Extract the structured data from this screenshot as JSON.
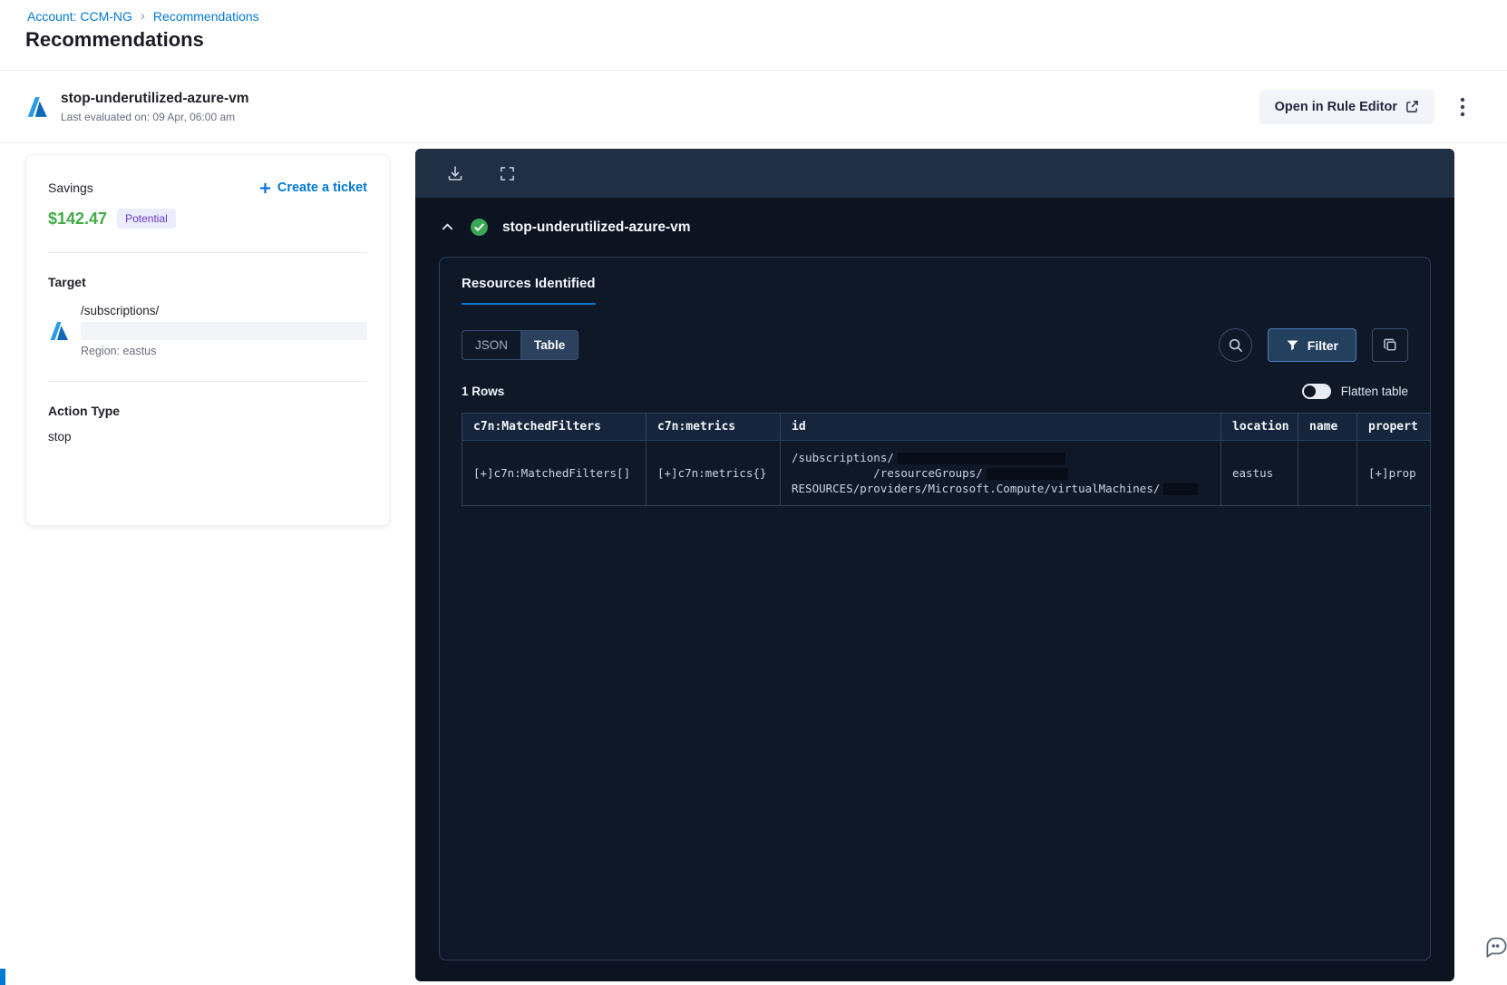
{
  "colors": {
    "accent_blue": "#0278d5",
    "savings_green": "#42ab45",
    "badge_purple": "#6938c8",
    "panel_bg": "#0b1420"
  },
  "breadcrumb": {
    "account_link": "Account: CCM-NG",
    "separator": "›",
    "current": "Recommendations"
  },
  "page_title": "Recommendations",
  "recommendation_header": {
    "name": "stop-underutilized-azure-vm",
    "last_evaluated": "Last evaluated on: 09 Apr, 06:00 am",
    "open_rule_editor_label": "Open in Rule Editor"
  },
  "savings_card": {
    "savings_label": "Savings",
    "amount": "$142.47",
    "potential_badge": "Potential",
    "create_ticket_label": "Create a ticket",
    "target_label": "Target",
    "target_path": "/subscriptions/",
    "region": "Region: eastus",
    "action_type_label": "Action Type",
    "action_type_value": "stop"
  },
  "resource_panel": {
    "recommendation_name": "stop-underutilized-azure-vm",
    "tab_label": "Resources Identified",
    "json_toggle": "JSON",
    "table_toggle": "Table",
    "filter_label": "Filter",
    "rows_count": "1 Rows",
    "flatten_label": "Flatten table",
    "table": {
      "headers": [
        "c7n:MatchedFilters",
        "c7n:metrics",
        "id",
        "location",
        "name",
        "propert"
      ],
      "row": {
        "matched_filters": "[+]c7n:MatchedFilters[]",
        "metrics": "[+]c7n:metrics{}",
        "id_line_1": "/subscriptions/",
        "id_line_2": "            /resourceGroups/",
        "id_line_3": "RESOURCES/providers/Microsoft.Compute/virtualMachines/",
        "location": "eastus",
        "name": "",
        "properties": "[+]prop"
      }
    }
  }
}
